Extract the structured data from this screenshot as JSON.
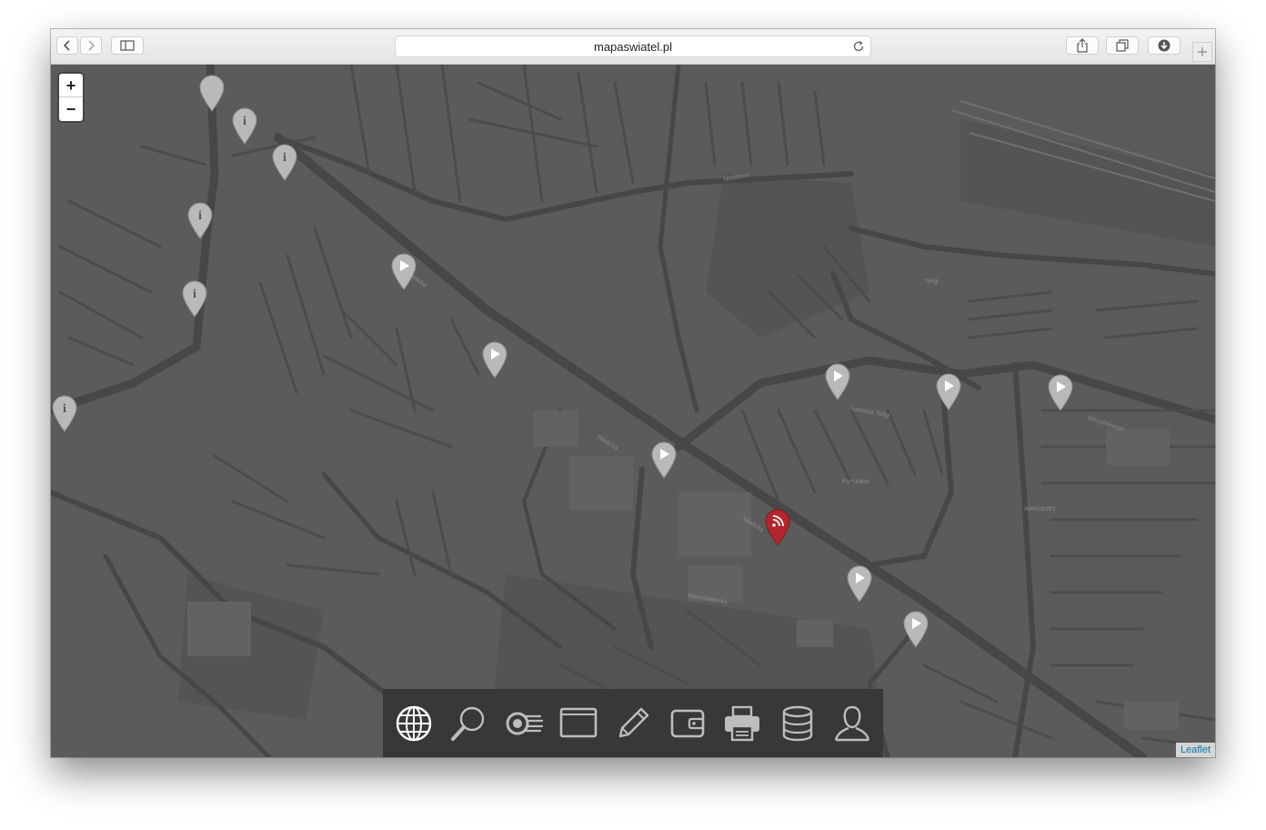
{
  "browser": {
    "url": "mapaswiatel.pl"
  },
  "map": {
    "zoom_in_label": "+",
    "zoom_out_label": "−",
    "attribution": "Leaflet",
    "colors": {
      "background": "#5b5b5b",
      "road": "#4a4a4a",
      "marker_gray": "#b9b9b9",
      "marker_red": "#b3262d"
    },
    "markers": [
      {
        "type": "info-icon"
      },
      {
        "type": "info-icon"
      },
      {
        "type": "info-icon"
      },
      {
        "type": "info-icon"
      },
      {
        "type": "info-icon"
      },
      {
        "type": "play-icon"
      },
      {
        "type": "play-icon"
      },
      {
        "type": "play-icon"
      },
      {
        "type": "play-icon"
      },
      {
        "type": "play-icon"
      },
      {
        "type": "play-icon"
      },
      {
        "type": "play-icon"
      },
      {
        "type": "play-icon"
      },
      {
        "type": "rss-icon"
      }
    ]
  },
  "dock": {
    "items": [
      "globe-icon",
      "search-icon",
      "light-signal-icon",
      "screen-icon",
      "pencil-icon",
      "wallet-icon",
      "printer-icon",
      "database-icon",
      "user-icon"
    ]
  }
}
